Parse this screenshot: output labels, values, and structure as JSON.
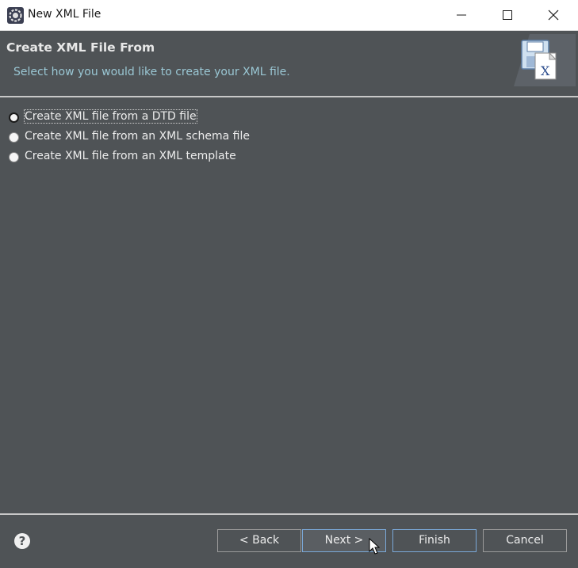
{
  "window": {
    "title": "New XML File",
    "icon": "eclipse-gear-icon",
    "controls": [
      "minimize-icon",
      "maximize-icon",
      "close-icon"
    ]
  },
  "header": {
    "title": "Create XML File From",
    "description": "Select how you would like to create your XML file.",
    "icon": "xml-file-wizard-icon"
  },
  "options": [
    {
      "label": "Create XML file from a DTD file",
      "selected": true
    },
    {
      "label": "Create XML file from an XML schema file",
      "selected": false
    },
    {
      "label": "Create XML file from an XML template",
      "selected": false
    }
  ],
  "buttons": {
    "back": "< Back",
    "next": "Next >",
    "finish": "Finish",
    "cancel": "Cancel"
  },
  "help": {
    "icon": "help-icon",
    "glyph": "?"
  },
  "colors": {
    "background": "#4f5356",
    "header_text": "#e8e8e8",
    "description_text": "#9ac7d4",
    "focus_border": "#7aa8d8"
  }
}
